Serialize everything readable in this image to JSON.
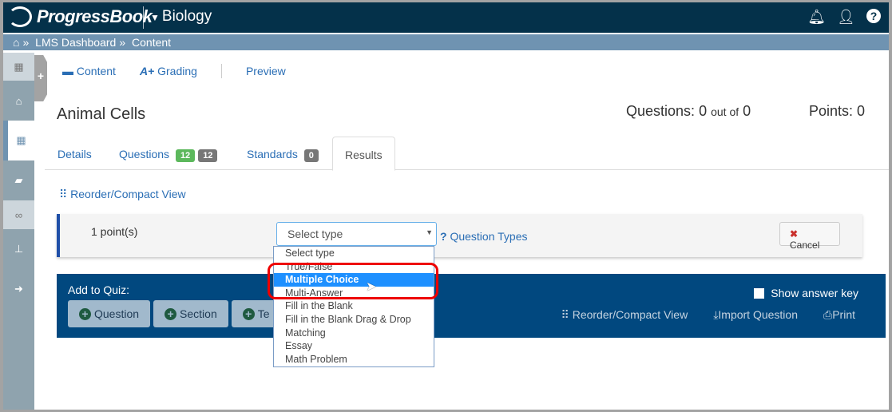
{
  "header": {
    "brand": "ProgressBook",
    "course": "Biology",
    "icons": [
      "bell-icon",
      "user-icon",
      "help-icon"
    ]
  },
  "breadcrumb": {
    "items": [
      "LMS Dashboard",
      "Content"
    ]
  },
  "sidebar": {
    "icons": [
      "calendar-icon",
      "home-icon",
      "dashboard-icon",
      "book-icon",
      "link-icon",
      "sitemap-icon",
      "sign-out-icon"
    ]
  },
  "subnav": {
    "content": "Content",
    "grading": "Grading",
    "preview": "Preview"
  },
  "page": {
    "title": "Animal Cells",
    "questions_label": "Questions:",
    "questions_value": "0",
    "out_of": "out of",
    "questions_total": "0",
    "points": "Points: 0"
  },
  "tabs": [
    {
      "label": "Details"
    },
    {
      "label": "Questions",
      "badge1": "12",
      "badge2": "12"
    },
    {
      "label": "Standards",
      "badge1": "0"
    },
    {
      "label": "Results"
    }
  ],
  "reorder": "Reorder/Compact View",
  "question": {
    "points": "1 point(s)",
    "select_value": "Select type",
    "question_types": "Question Types",
    "cancel": "Cancel"
  },
  "dropdown": {
    "options": [
      "Select type",
      "True/False",
      "Multiple Choice",
      "Multi-Answer",
      "Fill in the Blank",
      "Fill in the Blank Drag & Drop",
      "Matching",
      "Essay",
      "Math Problem"
    ],
    "highlighted": "Multiple Choice"
  },
  "toolbar": {
    "add_to_quiz": "Add to Quiz:",
    "question": "Question",
    "section": "Section",
    "third": "Te",
    "show_answer_key": "Show answer key",
    "reorder": "Reorder/Compact View",
    "import": "Import Question",
    "print": "Print"
  },
  "colors": {
    "topbar": "#04314a",
    "breadcrumb": "#6f93b1",
    "toolbar": "#01487f",
    "highlight": "#1e90ff",
    "badge_green": "#5cb85c",
    "badge_gray": "#777777",
    "annotation": "#ee0000"
  }
}
